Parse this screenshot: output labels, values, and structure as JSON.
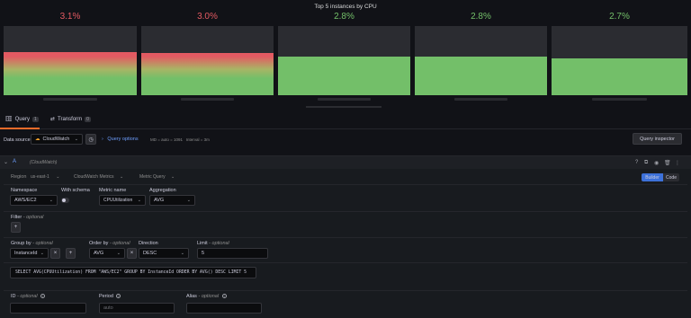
{
  "panel": {
    "title": "Top 5 instances by CPU",
    "gauges": [
      {
        "value_label": "3.1%",
        "value": 3.1,
        "color_top": "#e35a62",
        "color_bottom": "#73bf69",
        "fill_fraction": 0.62
      },
      {
        "value_label": "3.0%",
        "value": 3.0,
        "color_top": "#e35a62",
        "color_bottom": "#73bf69",
        "fill_fraction": 0.61
      },
      {
        "value_label": "2.8%",
        "value": 2.8,
        "color_top": "#73bf69",
        "color_bottom": "#73bf69",
        "fill_fraction": 0.56
      },
      {
        "value_label": "2.8%",
        "value": 2.8,
        "color_top": "#73bf69",
        "color_bottom": "#73bf69",
        "fill_fraction": 0.56
      },
      {
        "value_label": "2.7%",
        "value": 2.7,
        "color_top": "#73bf69",
        "color_bottom": "#73bf69",
        "fill_fraction": 0.53
      }
    ]
  },
  "tabs": [
    {
      "label": "Query",
      "count": "1"
    },
    {
      "label": "Transform",
      "count": "0"
    }
  ],
  "datasource": {
    "label": "Data source",
    "name": "CloudWatch",
    "query_options_label": "Query options",
    "query_options_meta": "MD = auto = 1091   Interval = 3m",
    "inspector_label": "Query inspector"
  },
  "query": {
    "ref_id": "A",
    "ds_name": "(CloudWatch)",
    "region_label": "Region",
    "region_value": "us-east-1",
    "api_value": "CloudWatch Metrics",
    "mode_value": "Metric Query",
    "builder_label": "Builder",
    "code_label": "Code",
    "namespace_label": "Namespace",
    "namespace_value": "AWS/EC2",
    "with_schema_label": "With schema",
    "metric_name_label": "Metric name",
    "metric_name_value": "CPUUtilization",
    "aggregation_label": "Aggregation",
    "aggregation_value": "AVG",
    "filter_label": "Filter",
    "optional": "- optional",
    "add_symbol": "+",
    "remove_symbol": "×",
    "group_by_label": "Group by",
    "group_by_value": "InstanceId",
    "order_by_label": "Order by",
    "order_by_value": "AVG",
    "direction_label": "Direction",
    "direction_value": "DESC",
    "limit_label": "Limit",
    "limit_value": "5",
    "sql": "SELECT AVG(CPUUtilization) FROM \"AWS/EC2\" GROUP BY InstanceId ORDER BY AVG() DESC LIMIT 5",
    "id_label": "ID",
    "period_label": "Period",
    "period_placeholder": "auto",
    "alias_label": "Alias"
  }
}
